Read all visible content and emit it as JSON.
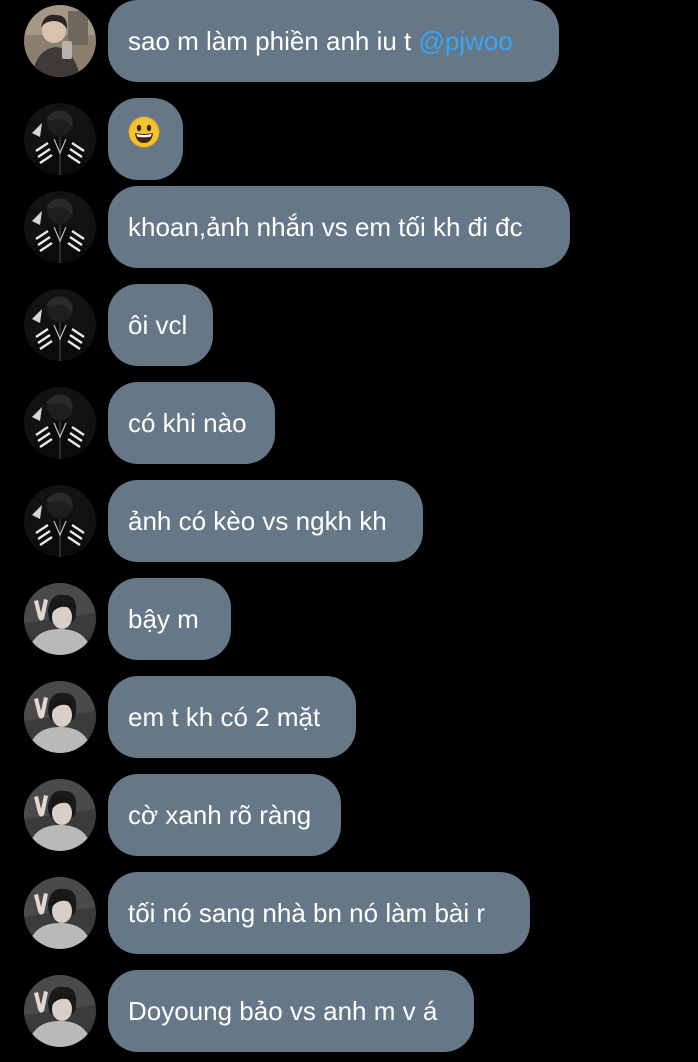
{
  "colors": {
    "background": "#000000",
    "bubble": "#667788",
    "text": "#ffffff",
    "mention": "#38a6f3"
  },
  "messages": [
    {
      "avatar": "avatar-selfie",
      "text": "sao m làm phiền anh iu t ",
      "mention": "@pjwoo"
    },
    {
      "avatar": "avatar-dark-jacket",
      "text": "",
      "emoji": "grinning-face-icon"
    },
    {
      "avatar": "avatar-dark-jacket",
      "text": "khoan,ảnh nhắn vs em tối kh đi đc"
    },
    {
      "avatar": "avatar-dark-jacket",
      "text": "ôi vcl"
    },
    {
      "avatar": "avatar-dark-jacket",
      "text": "có khi nào"
    },
    {
      "avatar": "avatar-dark-jacket",
      "text": "ảnh có kèo vs ngkh kh"
    },
    {
      "avatar": "avatar-peace-sign",
      "text": "bậy m"
    },
    {
      "avatar": "avatar-peace-sign",
      "text": "em t kh có 2 mặt"
    },
    {
      "avatar": "avatar-peace-sign",
      "text": "cờ xanh rõ ràng"
    },
    {
      "avatar": "avatar-peace-sign",
      "text": "tối nó sang nhà bn nó làm bài r"
    },
    {
      "avatar": "avatar-peace-sign",
      "text": "Doyoung bảo vs anh m v á"
    }
  ]
}
